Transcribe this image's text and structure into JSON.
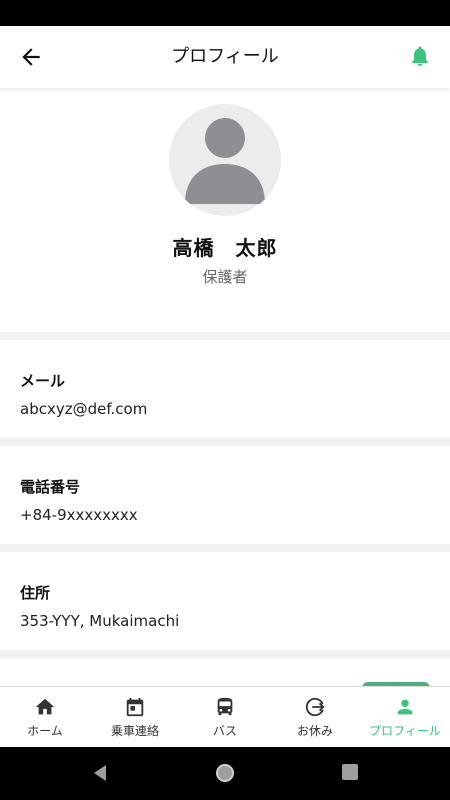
{
  "header": {
    "title": "プロフィール"
  },
  "profile": {
    "name": "高橋　太郎",
    "role": "保護者"
  },
  "fields": [
    {
      "label": "メール",
      "value": "abcxyz@def.com"
    },
    {
      "label": "電話番号",
      "value": "+84-9xxxxxxxx"
    },
    {
      "label": "住所",
      "value": "353-YYY, Mukaimachi"
    }
  ],
  "nav": {
    "items": [
      {
        "label": "ホーム",
        "icon": "home-icon"
      },
      {
        "label": "乗車連絡",
        "icon": "calendar-icon"
      },
      {
        "label": "バス",
        "icon": "bus-icon"
      },
      {
        "label": "お休み",
        "icon": "logout-icon"
      },
      {
        "label": "プロフィール",
        "icon": "person-icon",
        "active": true
      }
    ]
  },
  "colors": {
    "accent": "#3cc47c",
    "icon": "#333333"
  }
}
